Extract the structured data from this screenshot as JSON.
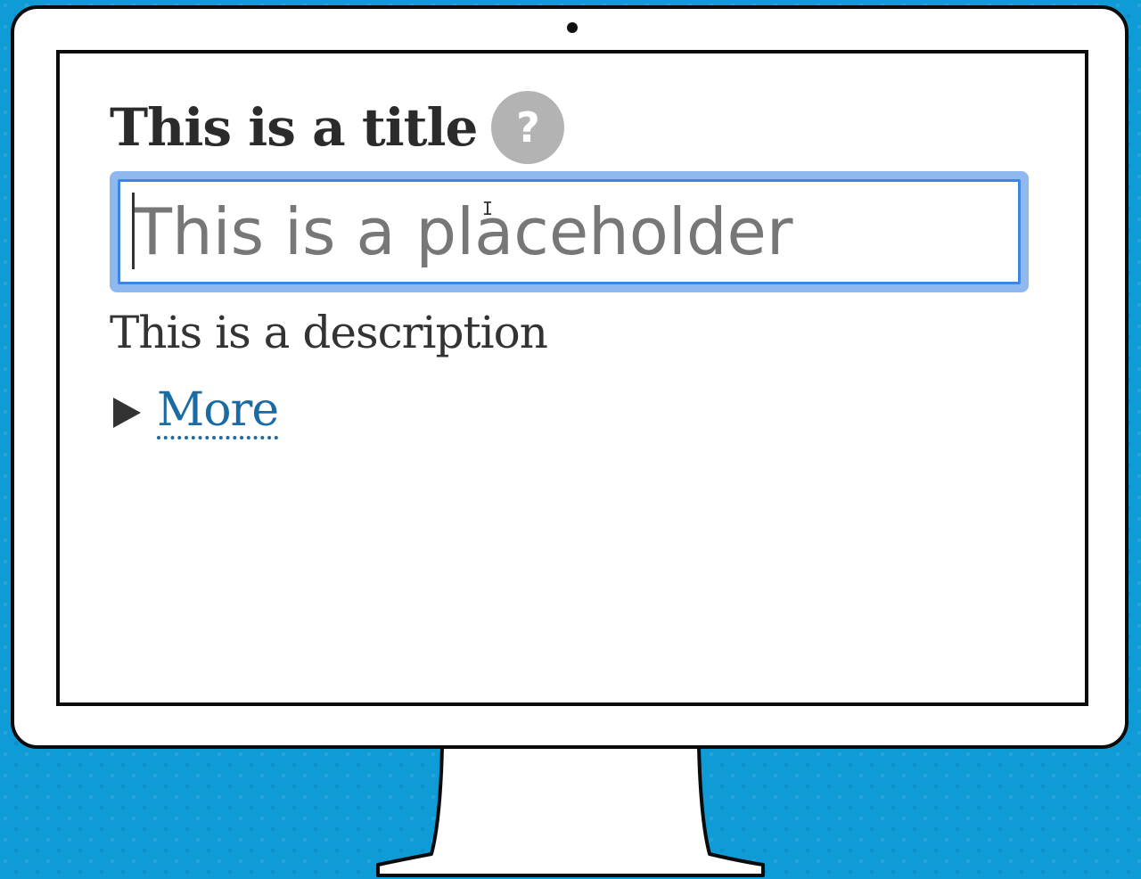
{
  "form_field": {
    "title": "This is a title",
    "help_icon_glyph": "?",
    "input": {
      "placeholder": "This is a placeholder",
      "value": "",
      "focused": true
    },
    "description": "This is a description",
    "more_link": "More"
  },
  "colors": {
    "background": "#0f9bd6",
    "focus_ring": "#3d86e6",
    "link": "#1a6aa3",
    "help_icon": "#b3b3b3"
  },
  "icons": {
    "help": "question-circle-icon",
    "disclosure": "triangle-right-icon",
    "cursor": "ibeam-cursor-icon"
  }
}
